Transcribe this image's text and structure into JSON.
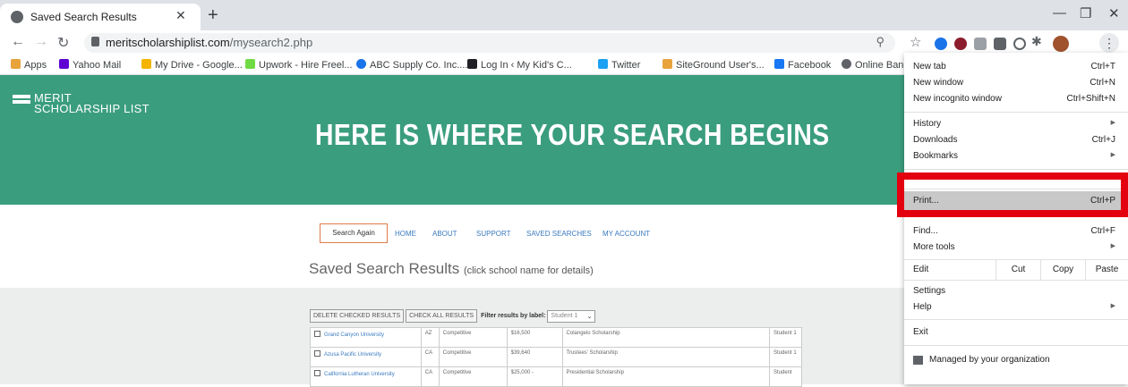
{
  "browser": {
    "tab_title": "Saved Search Results",
    "new_tab_glyph": "+",
    "url_domain": "meritscholarshiplist.com",
    "url_path": "/mysearch2.php",
    "bookmarks": [
      {
        "label": "Apps",
        "icon": "apps-grid-icon",
        "color": "#e8a33d"
      },
      {
        "label": "Yahoo Mail",
        "icon": "yahoo-mail-icon",
        "color": "#6001d2"
      },
      {
        "label": "My Drive - Google...",
        "icon": "google-drive-icon",
        "color": "#f4b400"
      },
      {
        "label": "Upwork - Hire Freel...",
        "icon": "upwork-icon",
        "color": "#6fda44"
      },
      {
        "label": "ABC Supply Co. Inc....",
        "icon": "abc-supply-icon",
        "color": "#1a73e8"
      },
      {
        "label": "Log In ‹ My Kid's C...",
        "icon": "graduation-cap-icon",
        "color": "#202124"
      },
      {
        "label": "Twitter",
        "icon": "twitter-icon",
        "color": "#1da1f2"
      },
      {
        "label": "SiteGround User's...",
        "icon": "siteground-icon",
        "color": "#e8a33d"
      },
      {
        "label": "Facebook",
        "icon": "facebook-icon",
        "color": "#1877f2"
      },
      {
        "label": "Online Banking Lo",
        "icon": "globe-icon",
        "color": "#5f6368"
      }
    ]
  },
  "page": {
    "logo_line1": "MERIT",
    "logo_line2": "SCHOLARSHIP LIST",
    "headline": "HERE IS WHERE YOUR SEARCH BEGINS",
    "nav": {
      "search_again": "Search Again",
      "links": [
        "HOME",
        "ABOUT",
        "SUPPORT",
        "SAVED SEARCHES",
        "MY ACCOUNT"
      ]
    },
    "results_title": "Saved Search Results",
    "results_hint": "(click school name for details)",
    "delete_btn": "DELETE CHECKED RESULTS",
    "check_all_btn": "CHECK ALL RESULTS",
    "filter_label": "Filter results by label:",
    "filter_value": "Student 1",
    "rows": [
      {
        "school": "Grand Canyon University",
        "state": "AZ",
        "type": "Competitive",
        "amount": "$16,500",
        "award": "Colangelo Scholarship",
        "label": "Student 1"
      },
      {
        "school": "Azusa Pacific University",
        "state": "CA",
        "type": "Competitive",
        "amount": "$39,640",
        "award": "Trustees' Scholarship",
        "label": "Student 1"
      },
      {
        "school": "California Lutheran University",
        "state": "CA",
        "type": "Competitive",
        "amount": "$25,000 -",
        "award": "Presidential Scholarship",
        "label": "Student"
      }
    ]
  },
  "menu": {
    "items": {
      "new_tab": "New tab",
      "new_tab_sc": "Ctrl+T",
      "new_window": "New window",
      "new_window_sc": "Ctrl+N",
      "incognito": "New incognito window",
      "incognito_sc": "Ctrl+Shift+N",
      "history": "History",
      "downloads": "Downloads",
      "downloads_sc": "Ctrl+J",
      "bookmarks": "Bookmarks",
      "print": "Print...",
      "print_sc": "Ctrl+P",
      "find": "Find...",
      "find_sc": "Ctrl+F",
      "more_tools": "More tools",
      "edit": "Edit",
      "cut": "Cut",
      "copy": "Copy",
      "paste": "Paste",
      "settings": "Settings",
      "help": "Help",
      "exit": "Exit",
      "managed": "Managed by your organization"
    },
    "highlight_color": "#e3000f"
  }
}
